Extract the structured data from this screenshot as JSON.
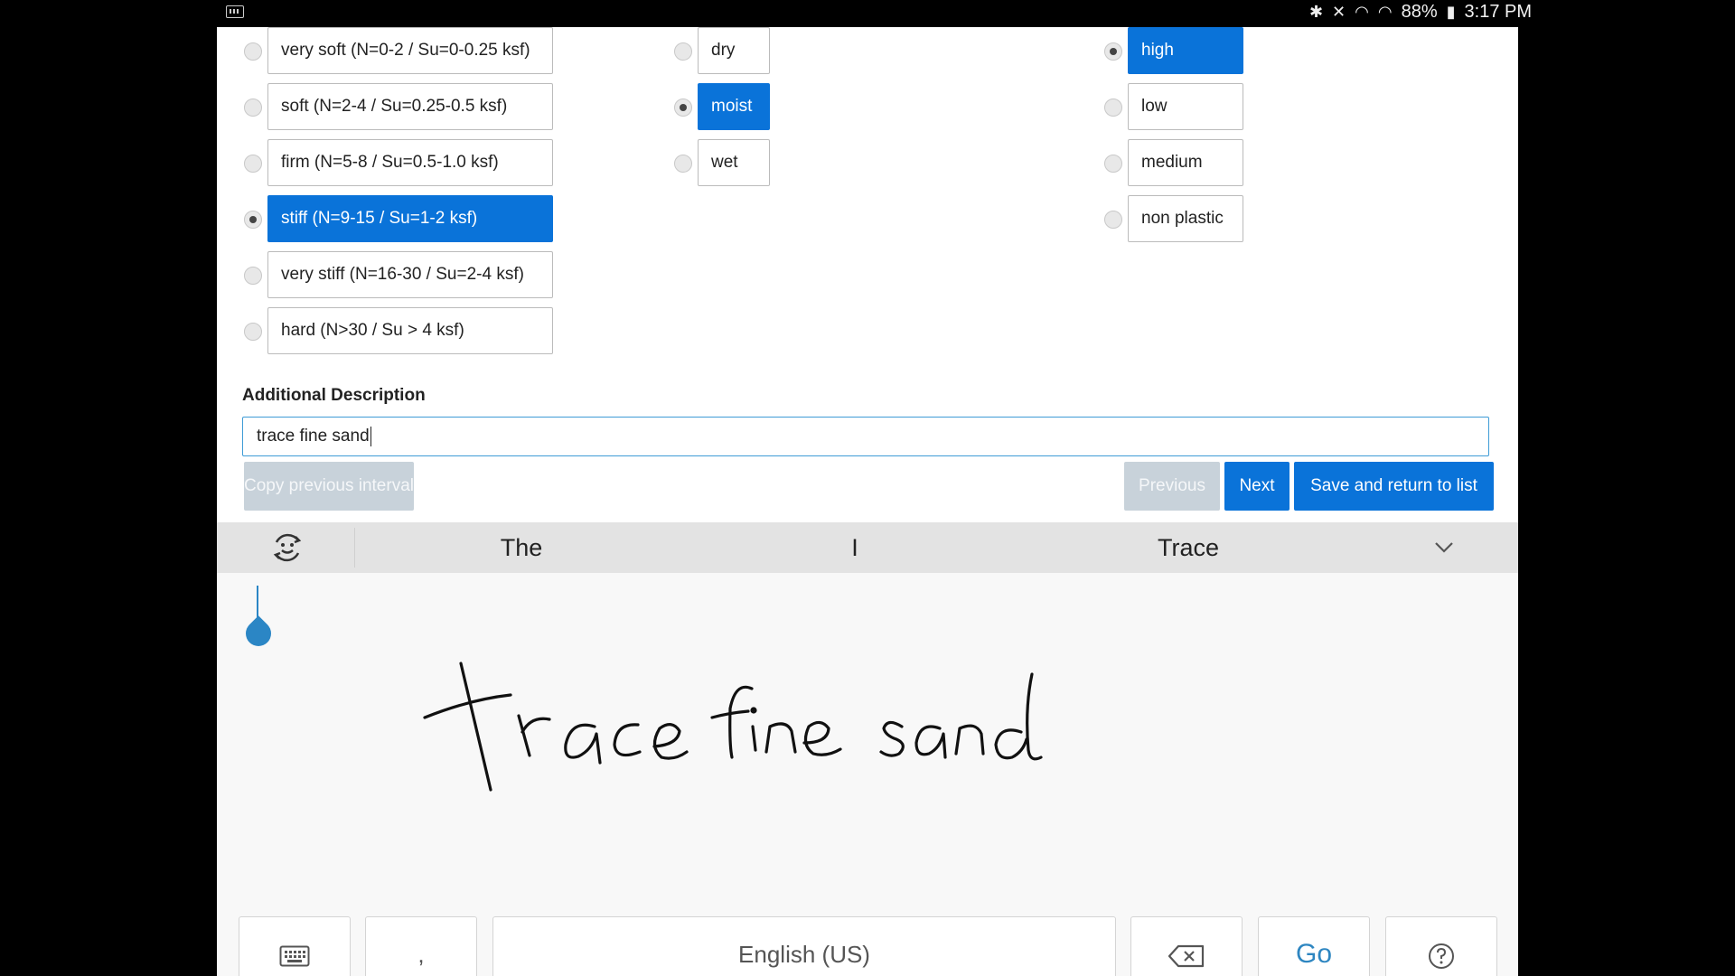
{
  "status_bar": {
    "battery": "88%",
    "time": "3:17 PM"
  },
  "consistency_options": [
    {
      "label": "very soft (N=0-2 / Su=0-0.25 ksf)",
      "selected": false
    },
    {
      "label": "soft (N=2-4 / Su=0.25-0.5 ksf)",
      "selected": false
    },
    {
      "label": "firm (N=5-8 / Su=0.5-1.0 ksf)",
      "selected": false
    },
    {
      "label": "stiff (N=9-15 / Su=1-2 ksf)",
      "selected": true
    },
    {
      "label": "very stiff (N=16-30 / Su=2-4 ksf)",
      "selected": false
    },
    {
      "label": "hard (N>30 / Su > 4 ksf)",
      "selected": false
    }
  ],
  "moisture_options": [
    {
      "label": "dry",
      "selected": false
    },
    {
      "label": "moist",
      "selected": true
    },
    {
      "label": "wet",
      "selected": false
    }
  ],
  "plasticity_options": [
    {
      "label": "high",
      "selected": true
    },
    {
      "label": "low",
      "selected": false
    },
    {
      "label": "medium",
      "selected": false
    },
    {
      "label": "non plastic",
      "selected": false
    }
  ],
  "additional_description": {
    "label": "Additional Description",
    "value": "trace fine sand"
  },
  "buttons": {
    "copy": "Copy previous interval",
    "previous": "Previous",
    "next": "Next",
    "save": "Save and return to list"
  },
  "keyboard": {
    "suggestions": [
      "The",
      "I",
      "Trace"
    ],
    "handwriting_text": "trace fine sand",
    "comma": ",",
    "language": "English (US)",
    "go": "Go"
  },
  "colors": {
    "accent": "#0a73d9",
    "disabled_button": "#c8d2da",
    "input_focus_border": "#3e9bd6",
    "go_key": "#2e86c1"
  }
}
